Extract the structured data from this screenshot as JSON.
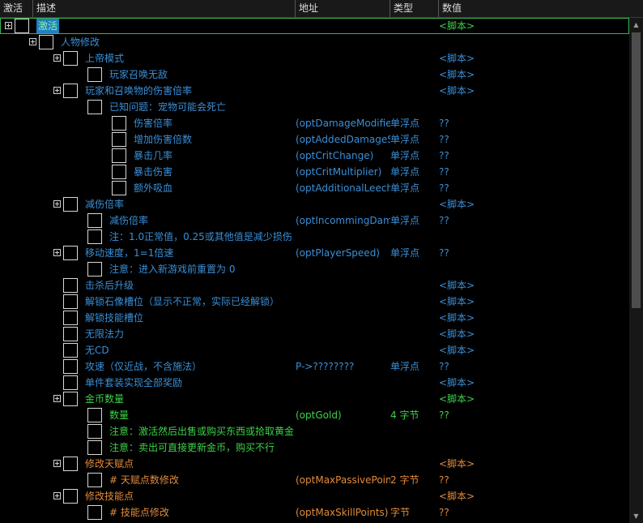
{
  "header": {
    "active": "激活",
    "desc": "描述",
    "addr": "地址",
    "type": "类型",
    "value": "数值"
  },
  "colors": {
    "blue": "#3a8fd8",
    "green": "#3cd24a",
    "orange": "#e38a3a",
    "sel_bg": "#1f7fbf"
  },
  "rows": [
    {
      "name": "row-activate",
      "indent": 0,
      "exp": true,
      "sel": true,
      "desc": "激活",
      "addr": "",
      "type": "",
      "value": "<脚本>",
      "color": "green"
    },
    {
      "name": "row-character-mod",
      "indent": 1,
      "exp": true,
      "desc": "人物修改",
      "addr": "",
      "type": "",
      "value": "",
      "color": "blue"
    },
    {
      "name": "row-god-mode",
      "indent": 2,
      "exp": true,
      "desc": "上帝模式",
      "addr": "",
      "type": "",
      "value": "<脚本>",
      "color": "blue"
    },
    {
      "name": "row-invincible",
      "indent": 3,
      "exp": false,
      "desc": "玩家召唤无敌",
      "addr": "",
      "type": "",
      "value": "<脚本>",
      "color": "blue"
    },
    {
      "name": "row-damage-multiplier-group",
      "indent": 2,
      "exp": true,
      "desc": "玩家和召唤物的伤害倍率",
      "addr": "",
      "type": "",
      "value": "<脚本>",
      "color": "blue"
    },
    {
      "name": "row-known-issue",
      "indent": 3,
      "exp": false,
      "desc": "已知问题：宠物可能会死亡",
      "addr": "",
      "type": "",
      "value": "",
      "color": "blue"
    },
    {
      "name": "row-damage-mult",
      "indent": 4,
      "exp": false,
      "desc": "伤害倍率",
      "addr": "(optDamageModifie",
      "type": "单浮点",
      "value": "??",
      "color": "blue"
    },
    {
      "name": "row-added-damage",
      "indent": 4,
      "exp": false,
      "desc": "增加伤害倍数",
      "addr": "(optAddedDamageS",
      "type": "单浮点",
      "value": "??",
      "color": "blue"
    },
    {
      "name": "row-crit-chance",
      "indent": 4,
      "exp": false,
      "desc": "暴击几率",
      "addr": "(optCritChange)",
      "type": "单浮点",
      "value": "??",
      "color": "blue"
    },
    {
      "name": "row-crit-damage",
      "indent": 4,
      "exp": false,
      "desc": "暴击伤害",
      "addr": "(optCritMultiplier)",
      "type": "单浮点",
      "value": "??",
      "color": "blue"
    },
    {
      "name": "row-leech",
      "indent": 4,
      "exp": false,
      "desc": "额外吸血",
      "addr": "(optAdditionalLeech",
      "type": "单浮点",
      "value": "??",
      "color": "blue"
    },
    {
      "name": "row-damage-reduction-group",
      "indent": 2,
      "exp": true,
      "desc": "减伤倍率",
      "addr": "",
      "type": "",
      "value": "<脚本>",
      "color": "blue"
    },
    {
      "name": "row-damage-reduction",
      "indent": 3,
      "exp": false,
      "desc": "减伤倍率",
      "addr": "(optIncommingDam",
      "type": "单浮点",
      "value": "??",
      "color": "blue"
    },
    {
      "name": "row-reduction-note",
      "indent": 3,
      "exp": false,
      "desc": "注：1.0正常值，0.25或其他值是减少损伤",
      "addr": "",
      "type": "",
      "value": "",
      "color": "blue"
    },
    {
      "name": "row-move-speed",
      "indent": 2,
      "exp": true,
      "desc": "移动速度，1=1倍速",
      "addr": "(optPlayerSpeed)",
      "type": "单浮点",
      "value": "??",
      "color": "blue"
    },
    {
      "name": "row-speed-note",
      "indent": 3,
      "exp": false,
      "desc": "注意：进入新游戏前重置为 0",
      "addr": "",
      "type": "",
      "value": "",
      "color": "blue"
    },
    {
      "name": "row-kill-levelup",
      "indent": 2,
      "exp": false,
      "desc": "击杀后升级",
      "addr": "",
      "type": "",
      "value": "<脚本>",
      "color": "blue"
    },
    {
      "name": "row-unlock-statue",
      "indent": 2,
      "exp": false,
      "desc": "解锁石像槽位（显示不正常，实际已经解锁）",
      "addr": "",
      "type": "",
      "value": "<脚本>",
      "color": "blue"
    },
    {
      "name": "row-unlock-skill-slot",
      "indent": 2,
      "exp": false,
      "desc": "解锁技能槽位",
      "addr": "",
      "type": "",
      "value": "<脚本>",
      "color": "blue"
    },
    {
      "name": "row-infinite-mana",
      "indent": 2,
      "exp": false,
      "desc": "无限法力",
      "addr": "",
      "type": "",
      "value": "<脚本>",
      "color": "blue"
    },
    {
      "name": "row-no-cd",
      "indent": 2,
      "exp": false,
      "desc": "无CD",
      "addr": "",
      "type": "",
      "value": "<脚本>",
      "color": "blue"
    },
    {
      "name": "row-attack-speed",
      "indent": 2,
      "exp": false,
      "desc": "攻速（仅近战，不含施法）",
      "addr": "P->????????",
      "type": "单浮点",
      "value": "??",
      "color": "blue"
    },
    {
      "name": "row-single-set",
      "indent": 2,
      "exp": false,
      "desc": "单件套装实现全部奖励",
      "addr": "",
      "type": "",
      "value": "<脚本>",
      "color": "blue"
    },
    {
      "name": "row-gold-group",
      "indent": 2,
      "exp": true,
      "desc": "金币数量",
      "addr": "",
      "type": "",
      "value": "<脚本>",
      "color": "green"
    },
    {
      "name": "row-gold-amount",
      "indent": 3,
      "exp": false,
      "desc": "数量",
      "addr": "(optGold)",
      "type": "4 字节",
      "value": "??",
      "color": "green"
    },
    {
      "name": "row-gold-note1",
      "indent": 3,
      "exp": false,
      "desc": "注意：激活然后出售或购买东西或拾取黄金",
      "addr": "",
      "type": "",
      "value": "",
      "color": "green"
    },
    {
      "name": "row-gold-note2",
      "indent": 3,
      "exp": false,
      "desc": "注意：卖出可直接更新金币，购买不行",
      "addr": "",
      "type": "",
      "value": "",
      "color": "green"
    },
    {
      "name": "row-talent-group",
      "indent": 2,
      "exp": true,
      "desc": "修改天赋点",
      "addr": "",
      "type": "",
      "value": "<脚本>",
      "color": "orange"
    },
    {
      "name": "row-talent-points",
      "indent": 3,
      "exp": false,
      "desc": "# 天赋点数修改",
      "addr": "(optMaxPassivePoin",
      "type": "2 字节",
      "value": "??",
      "color": "orange"
    },
    {
      "name": "row-skill-group",
      "indent": 2,
      "exp": true,
      "desc": "修改技能点",
      "addr": "",
      "type": "",
      "value": "<脚本>",
      "color": "orange"
    },
    {
      "name": "row-skill-points",
      "indent": 3,
      "exp": false,
      "desc": "# 技能点修改",
      "addr": "(optMaxSkillPoints)",
      "type": "字节",
      "value": "??",
      "color": "orange"
    }
  ]
}
